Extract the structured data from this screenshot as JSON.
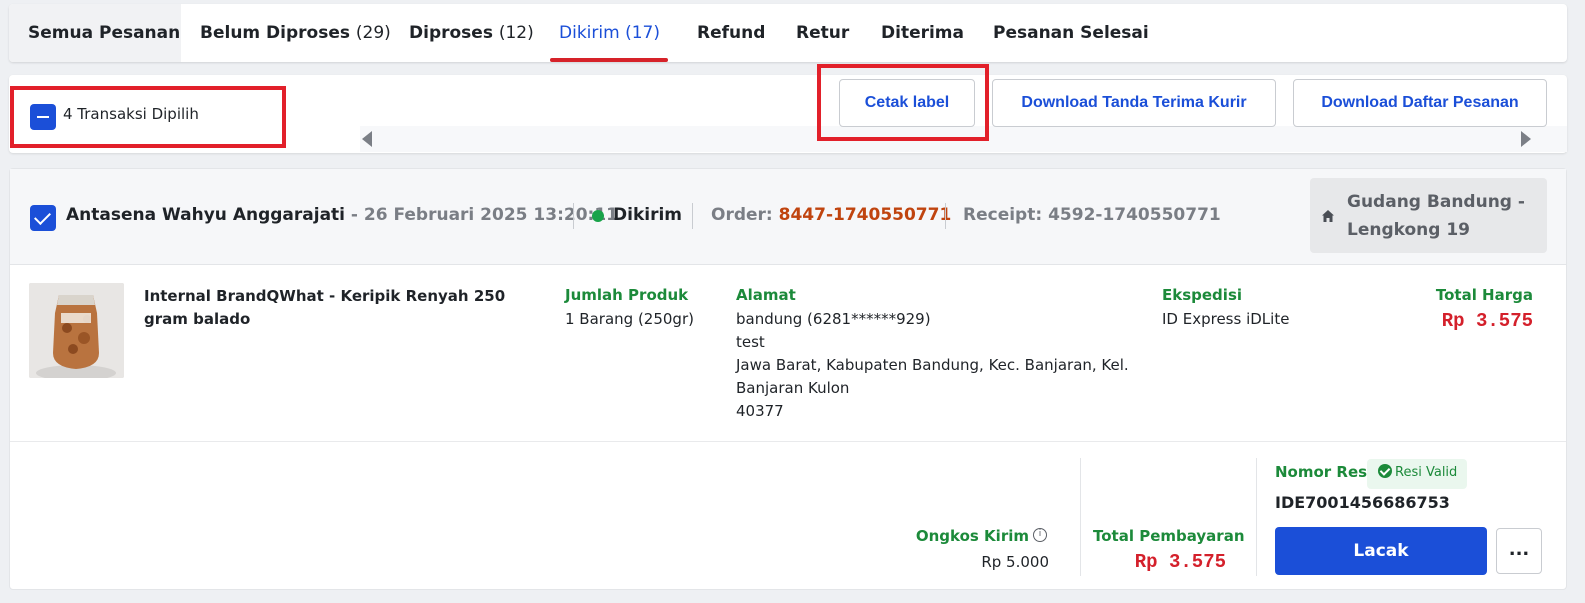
{
  "tabs": [
    {
      "label": "Semua Pesanan",
      "count": ""
    },
    {
      "label": "Belum Diproses",
      "count": "(29)"
    },
    {
      "label": "Diproses",
      "count": "(12)"
    },
    {
      "label": "Dikirim",
      "count": "(17)"
    },
    {
      "label": "Refund",
      "count": ""
    },
    {
      "label": "Retur",
      "count": ""
    },
    {
      "label": "Diterima",
      "count": ""
    },
    {
      "label": "Pesanan Selesai",
      "count": ""
    }
  ],
  "active_tab": "Dikirim",
  "actions": {
    "selected_label": "4 Transaksi Dipilih",
    "print_label": "Cetak label",
    "download_receipt": "Download Tanda Terima Kurir",
    "download_list": "Download Daftar Pesanan"
  },
  "order": {
    "buyer": "Antasena Wahyu Anggarajati",
    "date": "- 26 Februari 2025 13:20:11",
    "status": "Dikirim",
    "order_label": "Order:",
    "order_no": "8447-1740550771",
    "receipt_label": "Receipt:",
    "receipt_no": "4592-1740550771",
    "warehouse": "Gudang Bandung - Lengkong 19",
    "product": {
      "name": "Internal BrandQWhat - Keripik Renyah 250 gram balado",
      "qty_label": "Jumlah Produk",
      "qty": "1 Barang (250gr)"
    },
    "address": {
      "label": "Alamat",
      "line1": "bandung (6281******929)",
      "line2": "test",
      "line3": "Jawa Barat, Kabupaten Bandung, Kec. Banjaran, Kel.",
      "line4": "Banjaran Kulon",
      "line5": "40377"
    },
    "shipping": {
      "label": "Ekspedisi",
      "value": "ID Express iDLite"
    },
    "total_price": {
      "label": "Total Harga",
      "value": "Rp 3.575"
    },
    "shipping_fee": {
      "label": "Ongkos Kirim",
      "value": "Rp 5.000"
    },
    "total_payment": {
      "label": "Total Pembayaran",
      "value": "Rp 3.575"
    },
    "tracking": {
      "label": "Nomor Resi",
      "badge": "Resi Valid",
      "number": "IDE7001456686753",
      "track_button": "Lacak",
      "more_button": "..."
    }
  },
  "colors": {
    "accent": "#1b4fd8",
    "highlight": "#e2202a",
    "green": "#1c8a3a",
    "price": "#d4202b",
    "order": "#c0440f"
  }
}
